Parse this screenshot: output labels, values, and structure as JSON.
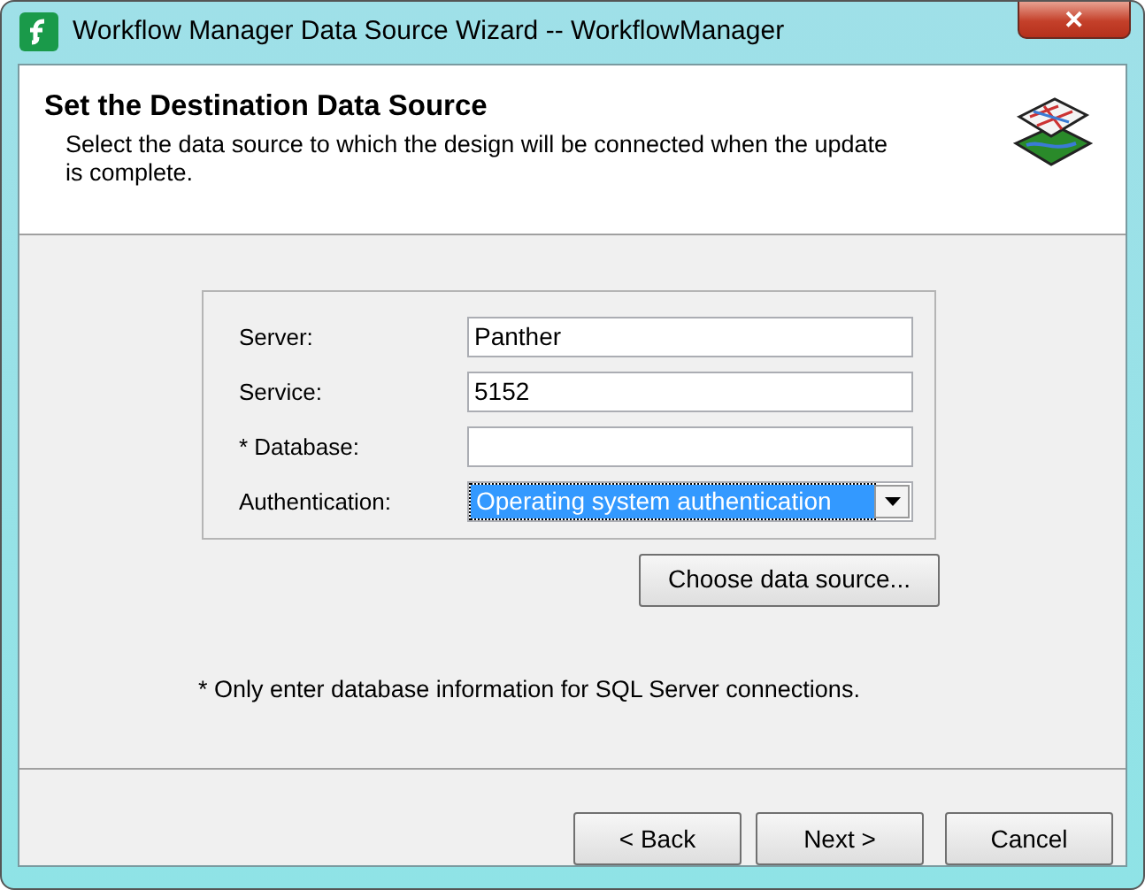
{
  "window": {
    "title": "Workflow Manager Data Source Wizard -- WorkflowManager",
    "close": "✕"
  },
  "header": {
    "title": "Set the Destination Data Source",
    "description": "Select the data source to which the design will be connected when the update is complete."
  },
  "fields": [
    {
      "kind": "text",
      "label": "Server:",
      "value": "Panther"
    },
    {
      "kind": "text",
      "label": "Service:",
      "value": "5152"
    },
    {
      "kind": "text",
      "label": "* Database:"
    },
    {
      "kind": "select",
      "label": "Authentication:",
      "value": "Operating system authentication",
      "focused": true
    }
  ],
  "choose_button": "Choose data source...",
  "footnote": "* Only enter database information for SQL Server connections.",
  "buttons": [
    "< Back",
    "Next >",
    "Cancel"
  ]
}
